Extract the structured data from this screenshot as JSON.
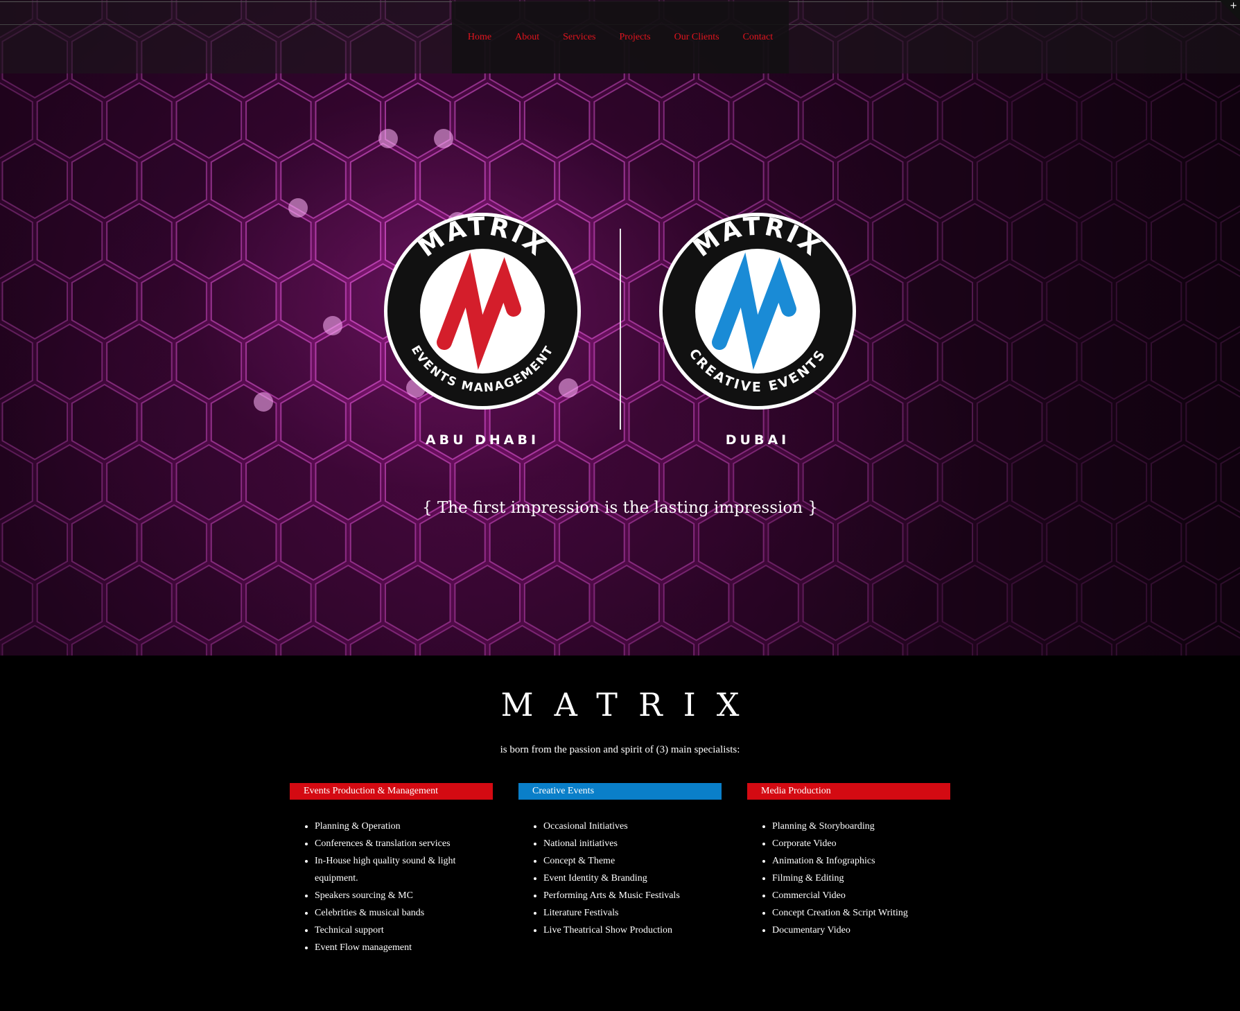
{
  "nav": {
    "items": [
      "Home",
      "About",
      "Services",
      "Projects",
      "Our Clients",
      "Contact"
    ],
    "color": "#e3141e"
  },
  "hero": {
    "logos": [
      {
        "top_text": "MATRIX",
        "bottom_text": "EVENTS MANAGEMENT",
        "mark_color": "#d41e2b",
        "city": "ABU DHABI"
      },
      {
        "top_text": "MATRIX",
        "bottom_text": "CREATIVE EVENTS",
        "mark_color": "#1a8bd6",
        "city": "DUBAI"
      }
    ],
    "tagline": "{ The first impression is the lasting impression }"
  },
  "about": {
    "brand": "MATRIX",
    "intro": "is born from the passion and spirit of (3) main specialists:"
  },
  "specialists": [
    {
      "title": "Events Production & Management",
      "color": "#d40a12",
      "items": [
        "Planning & Operation",
        "Conferences & translation services",
        "In-House high quality sound & light equipment.",
        "Speakers sourcing & MC",
        "Celebrities & musical bands",
        "Technical support",
        "Event Flow management"
      ]
    },
    {
      "title": "Creative Events",
      "color": "#0a7fc9",
      "items": [
        "Occasional Initiatives",
        "National initiatives",
        "Concept & Theme",
        "Event Identity & Branding",
        "Performing Arts & Music Festivals",
        "Literature Festivals",
        "Live Theatrical Show Production"
      ]
    },
    {
      "title": "Media Production",
      "color": "#d40a12",
      "items": [
        "Planning & Storyboarding",
        "Corporate Video",
        "Animation & Infographics",
        "Filming & Editing",
        "Commercial Video",
        "Concept Creation & Script Writing",
        "Documentary Video"
      ]
    }
  ],
  "icons": [
    "plus-icon",
    "matrix-events-logo",
    "matrix-creative-logo"
  ]
}
